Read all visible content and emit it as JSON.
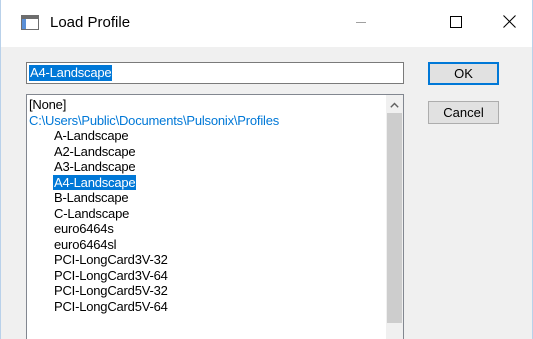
{
  "window": {
    "title": "Load Profile"
  },
  "profile_input": {
    "value": "A4-Landscape"
  },
  "buttons": {
    "ok_label": "OK",
    "cancel_label": "Cancel"
  },
  "list": {
    "none_label": "[None]",
    "path": "C:\\Users\\Public\\Documents\\Pulsonix\\Profiles",
    "items": [
      "A-Landscape",
      "A2-Landscape",
      "A3-Landscape",
      "A4-Landscape",
      "B-Landscape",
      "C-Landscape",
      "euro6464s",
      "euro6464sl",
      "PCI-LongCard3V-32",
      "PCI-LongCard3V-64",
      "PCI-LongCard5V-32",
      "PCI-LongCard5V-64"
    ],
    "selected_item": "A4-Landscape"
  },
  "colors": {
    "selection": "#0078d7",
    "path_text": "#0078d7",
    "dialog_bg": "#f0f0f0"
  },
  "icons": {
    "app": "dialog-window-icon",
    "minimize": "minimize-icon",
    "maximize": "maximize-icon",
    "close": "close-icon",
    "scroll_up": "chevron-up-icon"
  }
}
